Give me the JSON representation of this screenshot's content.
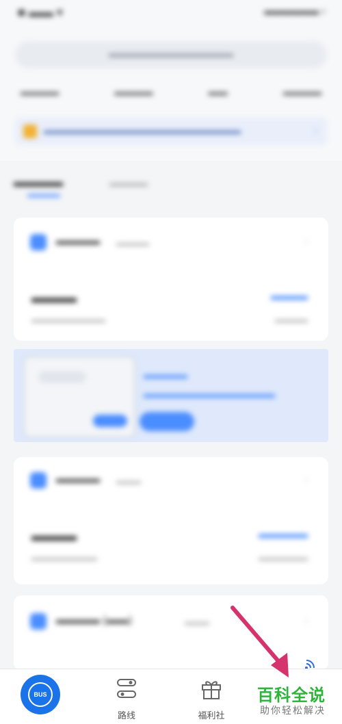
{
  "bottom_nav": {
    "bus_label": "BUS",
    "route_label": "路线",
    "welfare_label": "福利社"
  },
  "watermark": {
    "title": "百科全说",
    "subtitle": "助你轻松解决"
  },
  "colors": {
    "accent": "#4a8dff",
    "bus_button": "#1a73e8",
    "annotation_arrow": "#d6336c",
    "watermark_green": "#2fb33a"
  },
  "icons": {
    "bus": "bus-icon",
    "route": "route-icon",
    "welfare": "gift-icon"
  }
}
